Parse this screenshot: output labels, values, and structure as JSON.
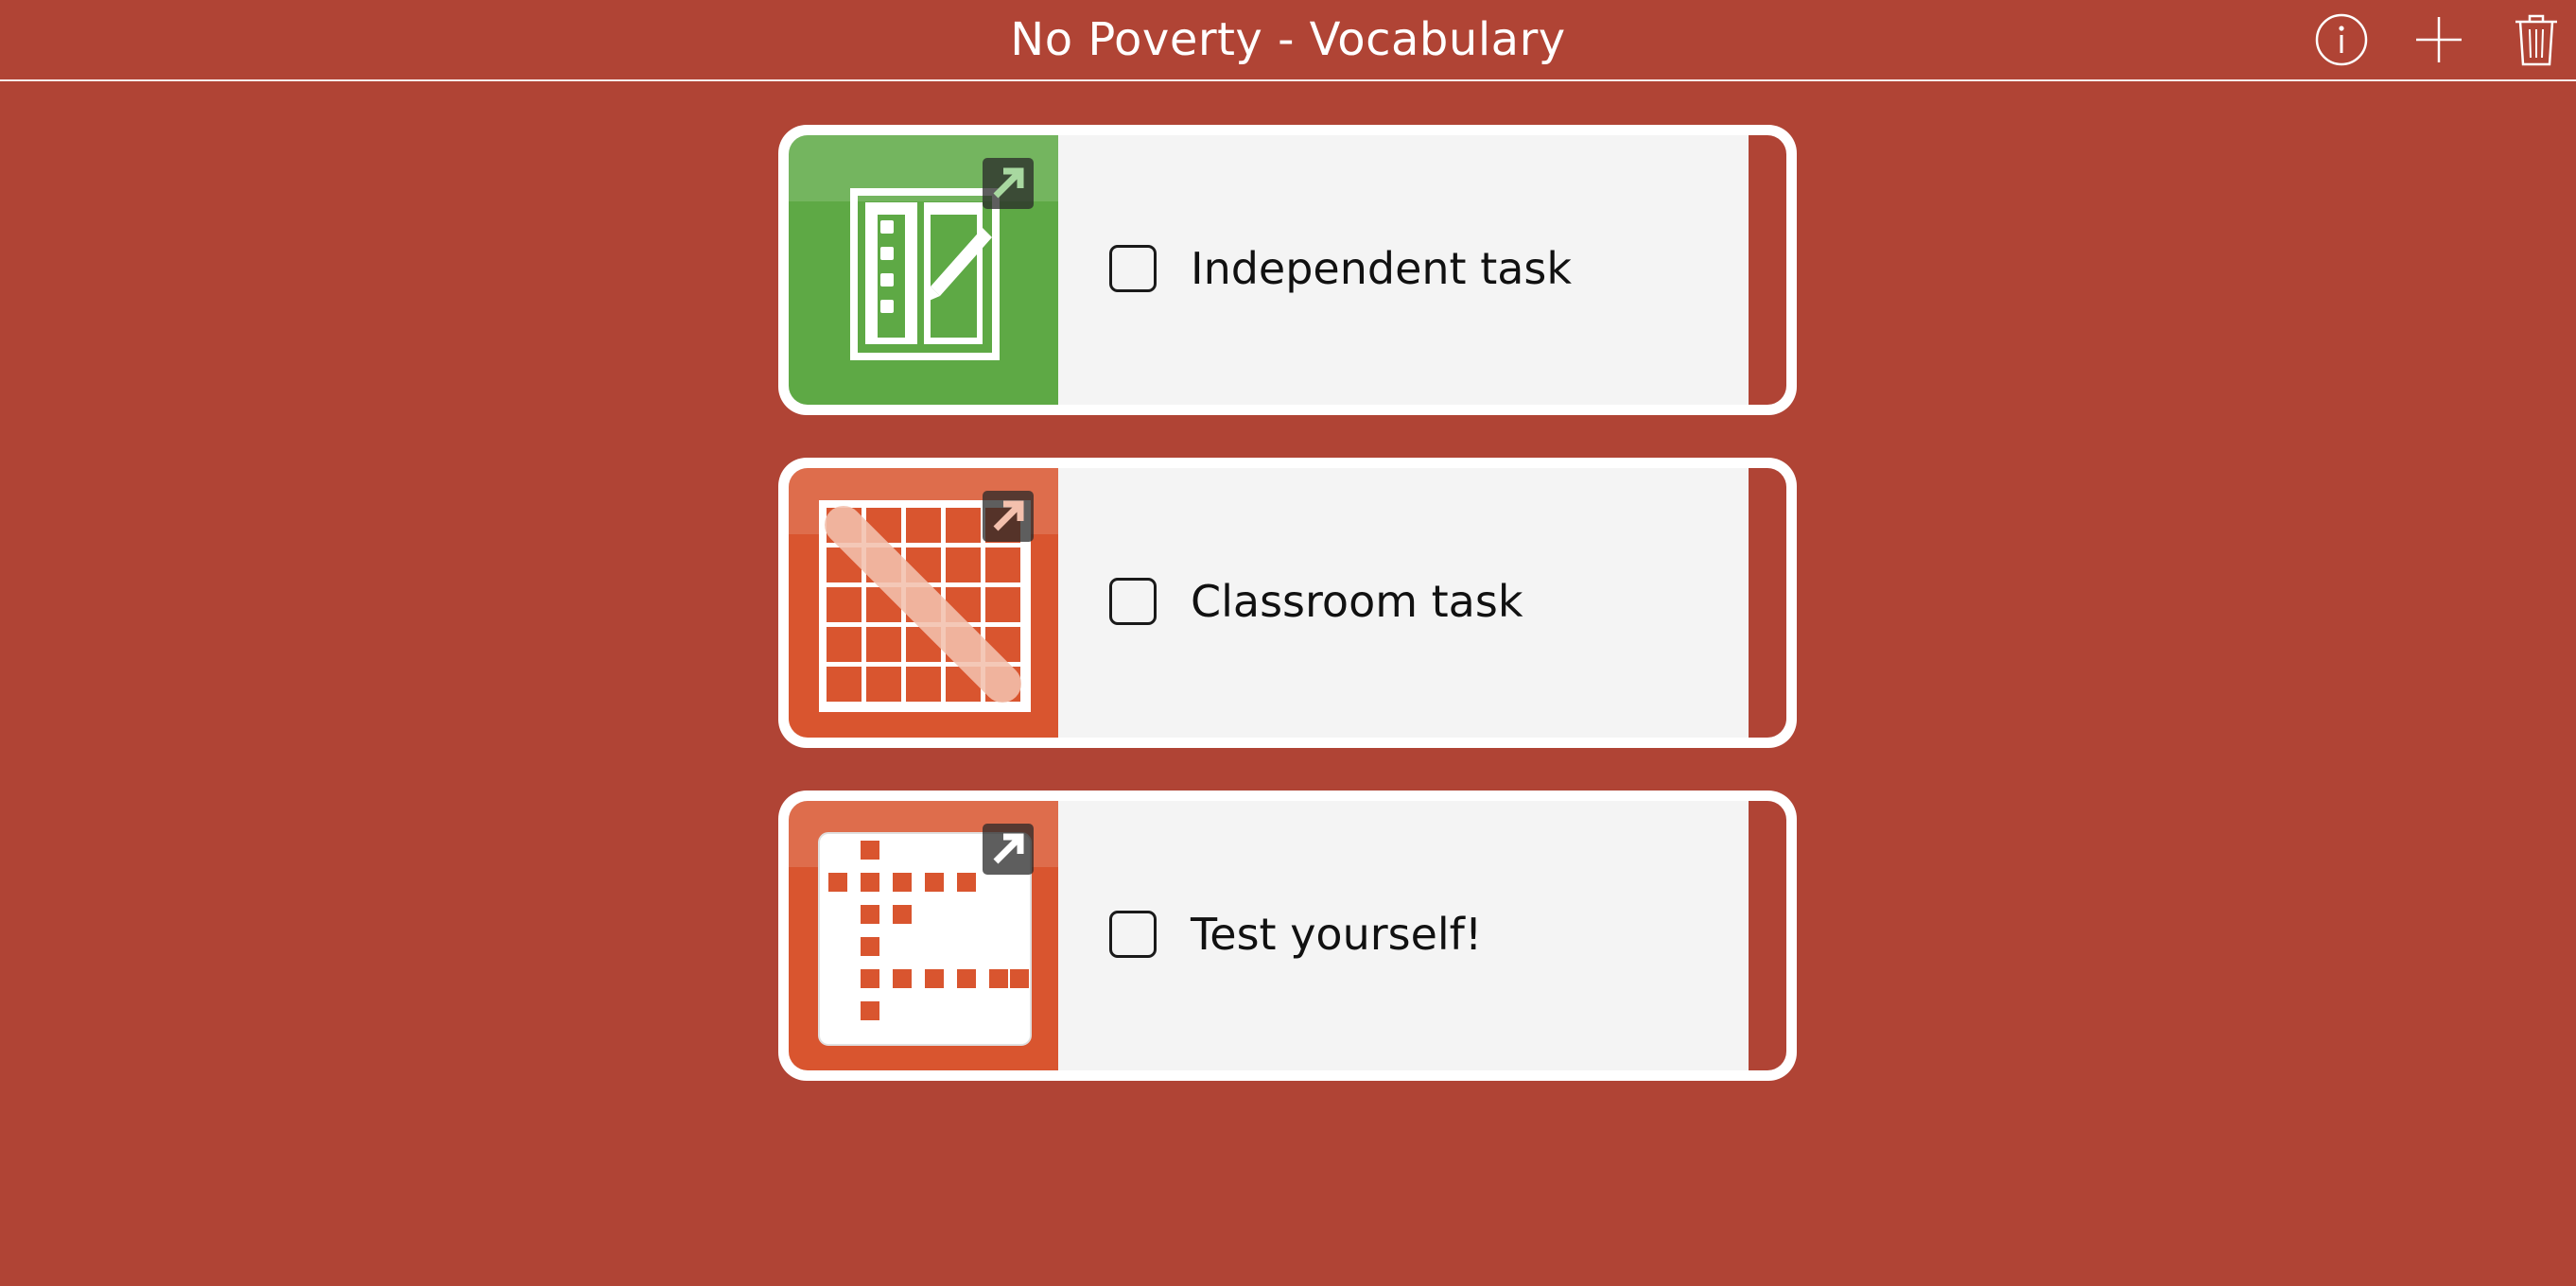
{
  "header": {
    "title": "No Poverty - Vocabulary",
    "info_icon": "info-icon",
    "add_icon": "plus-icon",
    "delete_icon": "trash-icon"
  },
  "tasks": [
    {
      "label": "Independent task",
      "checked": false,
      "icon": "worksheet-pencil-icon",
      "color": "#5ea945"
    },
    {
      "label": "Classroom task",
      "checked": false,
      "icon": "word-search-grid-icon",
      "color": "#d9552f"
    },
    {
      "label": "Test yourself!",
      "checked": false,
      "icon": "crossword-icon",
      "color": "#d9552f"
    }
  ],
  "colors": {
    "background": "#b04435",
    "card": "#f4f4f4",
    "green_thumb": "#5ea945",
    "orange_thumb": "#d9552f"
  }
}
